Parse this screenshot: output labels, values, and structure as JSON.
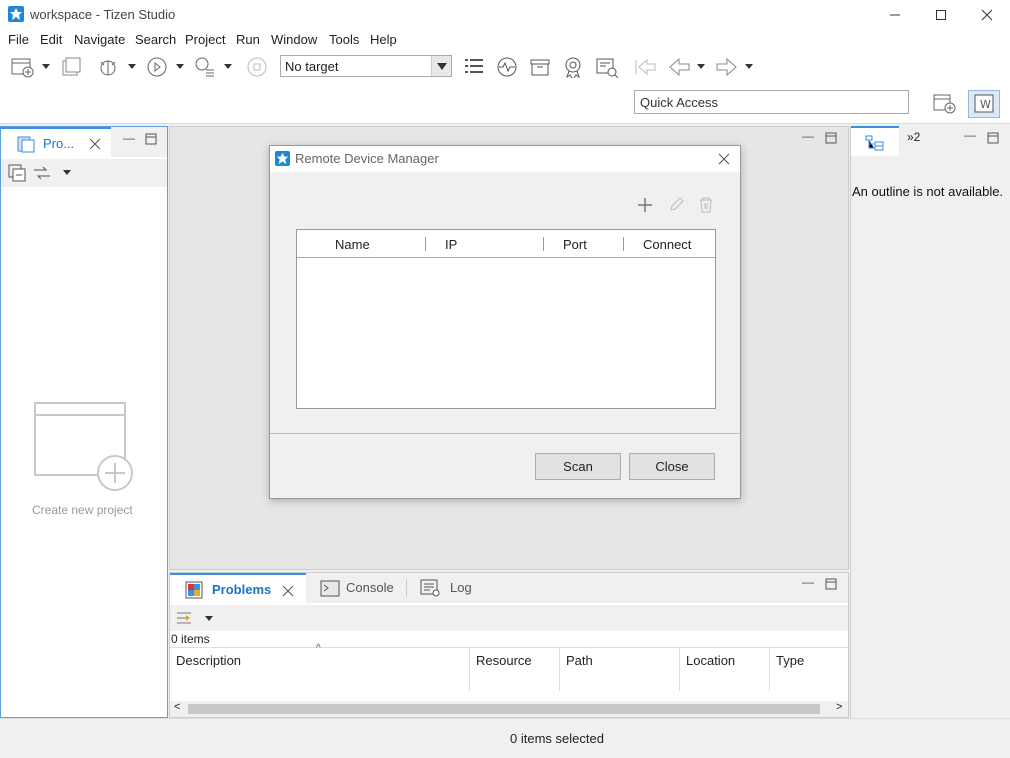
{
  "window": {
    "title": "workspace - Tizen Studio"
  },
  "menu": [
    "File",
    "Edit",
    "Navigate",
    "Search",
    "Project",
    "Run",
    "Window",
    "Tools",
    "Help"
  ],
  "toolbar": {
    "target_value": "No target",
    "quick_access_placeholder": "Quick Access"
  },
  "left_panel": {
    "tab_label": "Pro...",
    "create_label": "Create new project"
  },
  "right_panel": {
    "tab2_label": "»2",
    "outline_text": "An outline is not available."
  },
  "dialog": {
    "title": "Remote Device Manager",
    "columns": [
      "Name",
      "IP",
      "Port",
      "Connect"
    ],
    "scan_label": "Scan",
    "close_label": "Close"
  },
  "bottom_panel": {
    "tabs": [
      "Problems",
      "Console",
      "Log"
    ],
    "items_count": "0 items",
    "columns": [
      "Description",
      "Resource",
      "Path",
      "Location",
      "Type"
    ]
  },
  "status": {
    "text": "0 items selected"
  },
  "colors": {
    "accent": "#3a8ee6",
    "tab_text": "#1a73c8"
  }
}
